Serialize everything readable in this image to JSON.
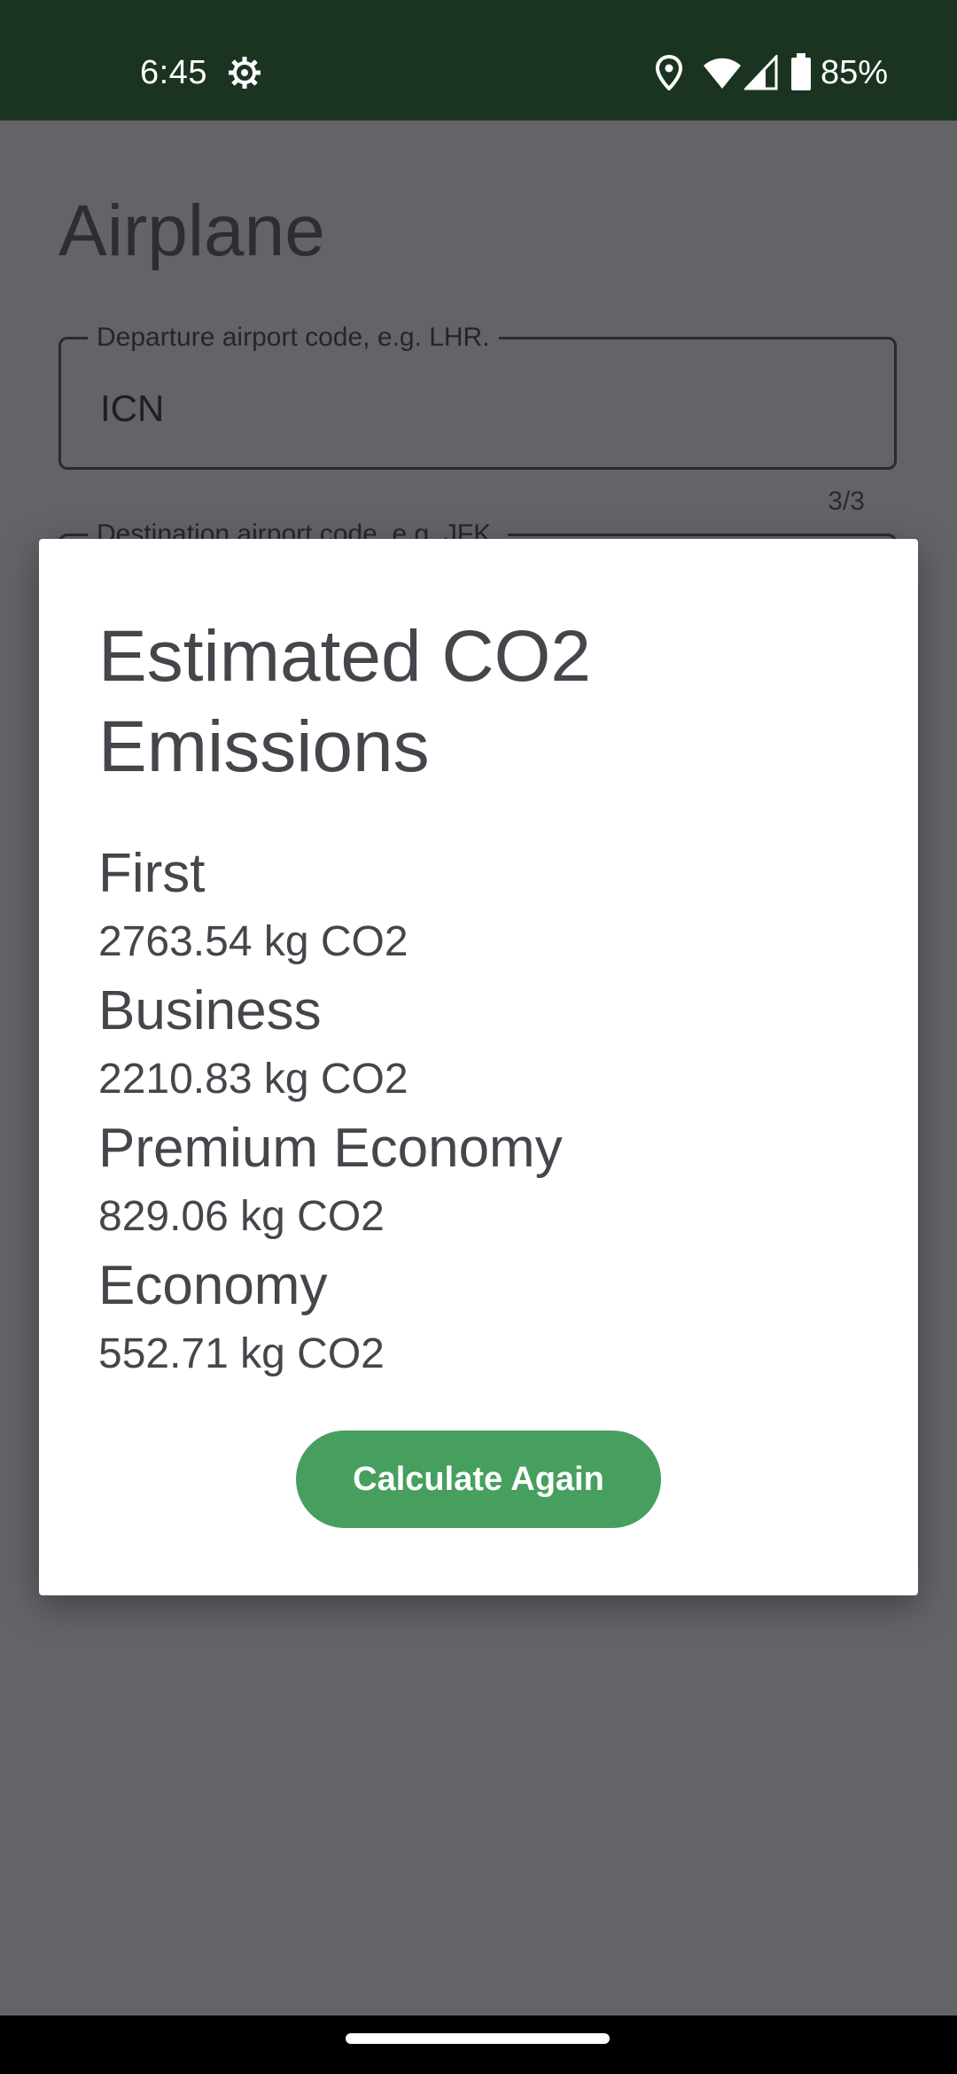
{
  "status_bar": {
    "time": "6:45",
    "battery": "85%",
    "icons": [
      "settings-gear-icon",
      "location-icon",
      "wifi-icon",
      "signal-icon",
      "battery-icon"
    ]
  },
  "screen": {
    "title": "Airplane",
    "departure_field": {
      "label": "Departure airport code, e.g. LHR.",
      "value": "ICN",
      "counter": "3/3"
    },
    "destination_field": {
      "label": "Destination airport code, e.g. JFK."
    }
  },
  "dialog": {
    "title": "Estimated CO2 Emissions",
    "results": [
      {
        "class_name": "First",
        "value": "2763.54 kg CO2"
      },
      {
        "class_name": "Business",
        "value": "2210.83 kg CO2"
      },
      {
        "class_name": "Premium Economy",
        "value": "829.06 kg CO2"
      },
      {
        "class_name": "Economy",
        "value": "552.71 kg CO2"
      }
    ],
    "button_label": "Calculate Again"
  },
  "colors": {
    "status_bar": "#1b3421",
    "scrim": "#646368",
    "button": "#479f5f",
    "dialog_text": "#46454c"
  }
}
